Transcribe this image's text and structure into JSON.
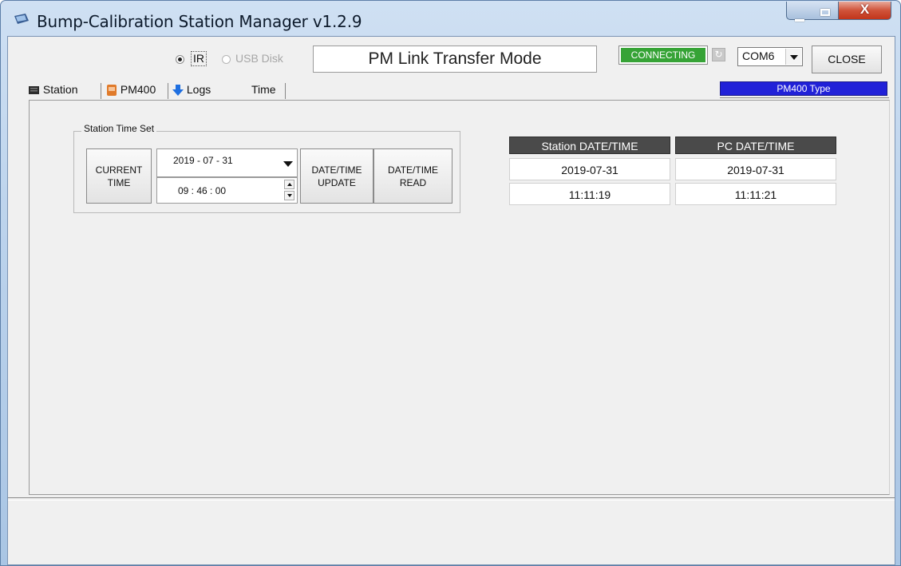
{
  "window": {
    "title": "Bump-Calibration Station Manager v1.2.9",
    "controls": {
      "minimize": "",
      "maximize": "",
      "close": "X"
    }
  },
  "transfer": {
    "options": [
      {
        "label": "IR",
        "selected": true,
        "enabled": true
      },
      {
        "label": "USB Disk",
        "selected": false,
        "enabled": false
      }
    ],
    "mode_text": "PM Link Transfer Mode"
  },
  "connection": {
    "status": "CONNECTING",
    "status_color": "#36a336",
    "port": "COM6",
    "close_label": "CLOSE",
    "device_type": "PM400 Type",
    "device_type_color": "#2121d8"
  },
  "tabs": [
    {
      "label": "Station",
      "icon": "station-icon",
      "active": false
    },
    {
      "label": "PM400",
      "icon": "pm400-icon",
      "active": false
    },
    {
      "label": "Logs",
      "icon": "download-arrow-icon",
      "active": false
    },
    {
      "label": "Time",
      "icon": "",
      "active": true
    }
  ],
  "time_set": {
    "group_title": "Station Time Set",
    "current_time_label": "CURRENT\nTIME",
    "date_value": "2019 - 07 - 31",
    "time_value": "09 : 46 : 00",
    "update_label": "DATE/TIME\nUPDATE",
    "read_label": "DATE/TIME\nREAD"
  },
  "datetime_table": {
    "headers": [
      "Station DATE/TIME",
      "PC DATE/TIME"
    ],
    "rows": [
      [
        "2019-07-31",
        "2019-07-31"
      ],
      [
        "11:11:19",
        "11:11:21"
      ]
    ]
  }
}
